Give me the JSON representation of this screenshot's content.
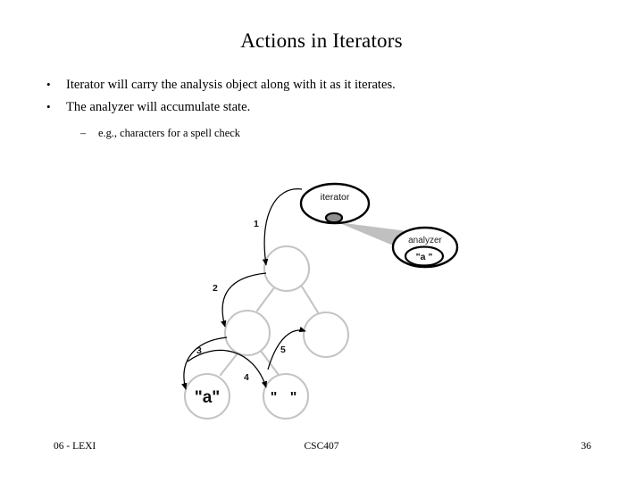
{
  "slide": {
    "title": "Actions in Iterators",
    "bullets": [
      {
        "marker": "•",
        "text": "Iterator will carry the analysis object along with it as it iterates."
      },
      {
        "marker": "•",
        "text": "The analyzer will accumulate state."
      }
    ],
    "sub_bullets": [
      {
        "marker": "–",
        "text": "e.g., characters for a spell check"
      }
    ]
  },
  "diagram": {
    "iterator_label": "iterator",
    "analyzer_label": "analyzer",
    "analyzer_token": "\"a \"",
    "leaf_left_label": "\"a\"",
    "leaf_right_label": "\"  \"",
    "step_labels": [
      "1",
      "2",
      "3",
      "4",
      "5"
    ],
    "colors": {
      "node_stroke": "#c4c4c4",
      "arrow": "#000000",
      "beam": "#c0c0c0",
      "object_stroke": "#000000"
    }
  },
  "footer": {
    "left": "06 - LEXI",
    "center": "CSC407",
    "right": "36"
  }
}
